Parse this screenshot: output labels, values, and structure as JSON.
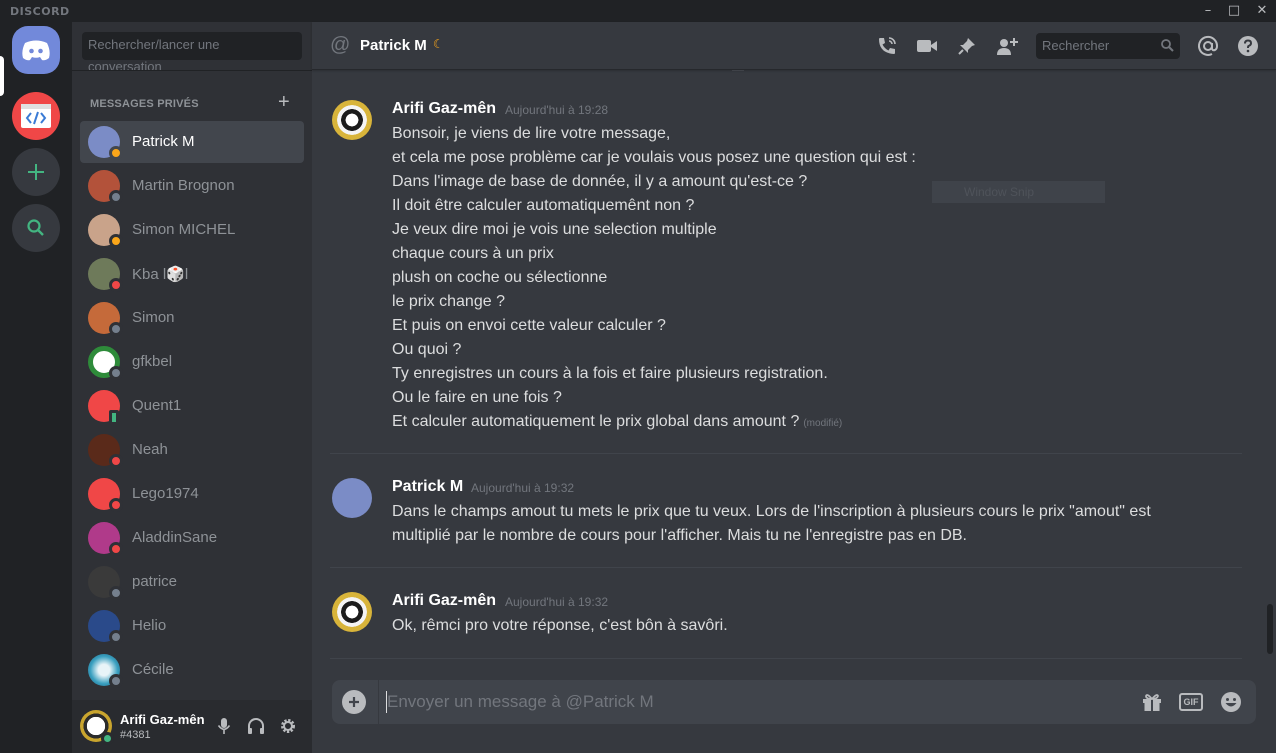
{
  "app": {
    "brand": "DISCORD"
  },
  "window": {
    "minimize_icon": "minimize-icon",
    "maximize_icon": "maximize-icon",
    "close_icon": "close-icon"
  },
  "guilds": [
    {
      "name": "home",
      "icon": "discord-logo-icon",
      "color": "#7289da"
    },
    {
      "name": "code-server",
      "icon": "code-icon",
      "color": "#f04747"
    },
    {
      "name": "add-server",
      "icon": "plus-icon",
      "color": "#43b581"
    },
    {
      "name": "explore",
      "icon": "search-icon",
      "color": "#43b581"
    }
  ],
  "sidebar": {
    "search_placeholder": "Rechercher/lancer une",
    "search_placeholder_overflow": "conversation",
    "dm_header": "MESSAGES PRIVÉS",
    "dm_add_icon": "plus-icon",
    "dms": [
      {
        "name": "Patrick M",
        "status": "idle",
        "active": true
      },
      {
        "name": "Martin Brognon",
        "status": "offline"
      },
      {
        "name": "Simon MICHEL",
        "status": "idle"
      },
      {
        "name": "Kba l🎲l",
        "status": "dnd"
      },
      {
        "name": "Simon",
        "status": "offline"
      },
      {
        "name": "gfkbel",
        "status": "offline"
      },
      {
        "name": "Quent1",
        "status": "online-mobile"
      },
      {
        "name": "Neah",
        "status": "dnd"
      },
      {
        "name": "Lego1974",
        "status": "dnd"
      },
      {
        "name": "AladdinSane",
        "status": "dnd"
      },
      {
        "name": "patrice",
        "status": "offline"
      },
      {
        "name": "Helio",
        "status": "offline"
      },
      {
        "name": "Cécile",
        "status": "offline"
      }
    ]
  },
  "user_panel": {
    "name": "Arifi Gaz-mên",
    "tag": "#4381",
    "status": "online"
  },
  "header": {
    "title": "Patrick M",
    "status_icon": "moon-icon",
    "search_placeholder": "Rechercher"
  },
  "messages": [
    {
      "author": "Arifi Gaz-mên",
      "time": "Aujourd'hui à 19:28",
      "lines": [
        "Bonsoir, je viens de lire votre message,",
        "et cela me pose problème car je voulais vous posez une question qui est :",
        "Dans l'image de base de donnée, il y a amount qu'est-ce ?",
        "Il doit être calculer automatiquemênt non ?",
        "Je veux dire moi je vois une selection multiple",
        "chaque cours à un prix",
        "plush on coche ou sélectionne",
        "le prix change ?",
        "Et puis on envoi cette valeur calculer ?",
        "Ou quoi ?",
        "Ty enregistres un cours à la fois et faire plusieurs registration.",
        "Ou le faire en une fois ?",
        "Et calculer automatiquement le prix global dans amount ?"
      ],
      "edited": "(modifié)"
    },
    {
      "author": "Patrick M",
      "time": "Aujourd'hui à 19:32",
      "lines": [
        "Dans le champs amout tu mets le prix que tu veux.  Lors de l'inscription à plusieurs cours le prix \"amout\" est",
        "multiplié par le nombre de cours pour l'afficher.  Mais tu ne l'enregistre pas en DB."
      ]
    },
    {
      "author": "Arifi Gaz-mên",
      "time": "Aujourd'hui à 19:32",
      "lines": [
        "Ok, rêmci pro votre réponse, c'est bôn à savôri."
      ]
    }
  ],
  "overlay": {
    "snip_label": "Window Snip"
  },
  "composer": {
    "placeholder": "Envoyer un message à @Patrick M",
    "gif_label": "GIF"
  }
}
